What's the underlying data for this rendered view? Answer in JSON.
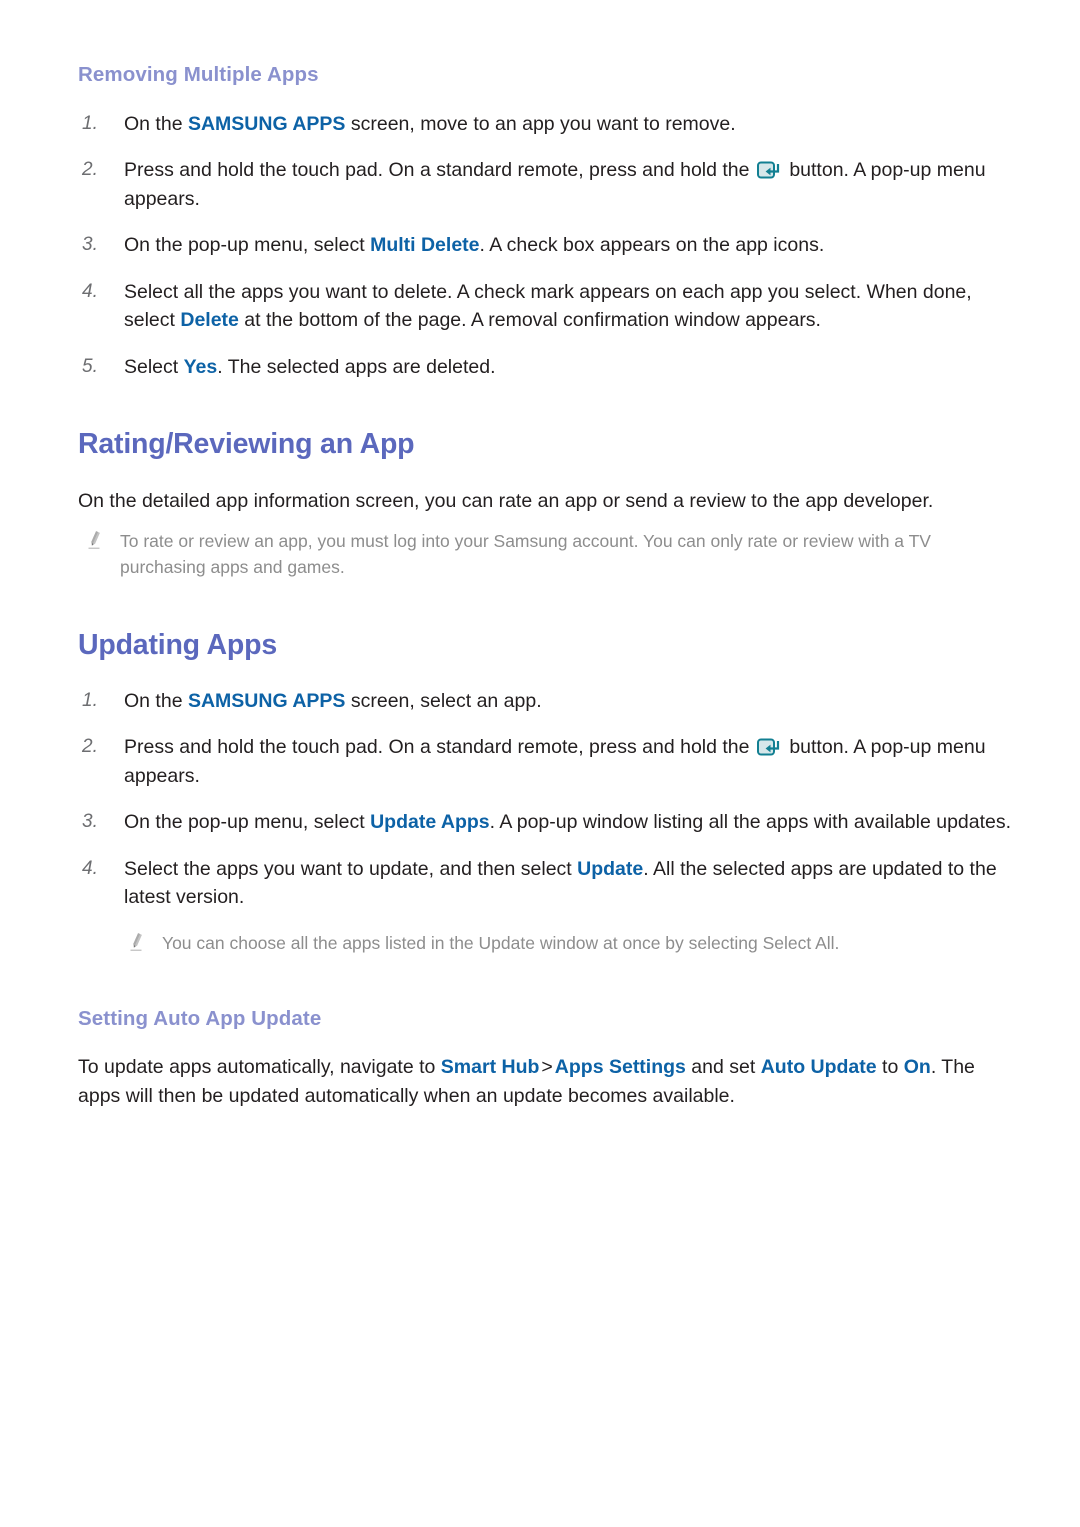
{
  "page": {
    "background": "#ffffff",
    "accent_heading_color": "#5b68bd",
    "accent_subheading_color": "#8a91ce",
    "link_color": "#0d62a6",
    "note_color": "#8d8d8d",
    "body_color": "#231f20"
  },
  "sections": [
    {
      "id": "removing-multiple-apps",
      "level": "h3",
      "title": "Removing Multiple Apps",
      "steps": [
        {
          "num": "1.",
          "parts": [
            {
              "t": "text",
              "v": "On the "
            },
            {
              "t": "hl",
              "v": "SAMSUNG APPS"
            },
            {
              "t": "text",
              "v": " screen, move to an app you want to remove."
            }
          ]
        },
        {
          "num": "2.",
          "parts": [
            {
              "t": "text",
              "v": "Press and hold the touch pad. On a standard remote, press and hold the "
            },
            {
              "t": "icon",
              "v": "enter-button-icon"
            },
            {
              "t": "text",
              "v": " button. A pop-up menu appears."
            }
          ]
        },
        {
          "num": "3.",
          "parts": [
            {
              "t": "text",
              "v": "On the pop-up menu, select "
            },
            {
              "t": "hl",
              "v": "Multi Delete"
            },
            {
              "t": "text",
              "v": ". A check box appears on the app icons."
            }
          ]
        },
        {
          "num": "4.",
          "parts": [
            {
              "t": "text",
              "v": "Select all the apps you want to delete. A check mark appears on each app you select. When done, select "
            },
            {
              "t": "hl",
              "v": "Delete"
            },
            {
              "t": "text",
              "v": " at the bottom of the page. A removal confirmation window appears."
            }
          ]
        },
        {
          "num": "5.",
          "parts": [
            {
              "t": "text",
              "v": "Select "
            },
            {
              "t": "hl",
              "v": "Yes"
            },
            {
              "t": "text",
              "v": ". The selected apps are deleted."
            }
          ]
        }
      ]
    },
    {
      "id": "rating-reviewing-an-app",
      "level": "h2",
      "title": "Rating/Reviewing an App",
      "paragraph": "On the detailed app information screen, you can rate an app or send a review to the app developer.",
      "note": "To rate or review an app, you must log into your Samsung account. You can only rate or review with a TV purchasing apps and games."
    },
    {
      "id": "updating-apps",
      "level": "h2",
      "title": "Updating Apps",
      "steps": [
        {
          "num": "1.",
          "parts": [
            {
              "t": "text",
              "v": "On the "
            },
            {
              "t": "hl",
              "v": "SAMSUNG APPS"
            },
            {
              "t": "text",
              "v": " screen, select an app."
            }
          ]
        },
        {
          "num": "2.",
          "parts": [
            {
              "t": "text",
              "v": "Press and hold the touch pad. On a standard remote, press and hold the "
            },
            {
              "t": "icon",
              "v": "enter-button-icon"
            },
            {
              "t": "text",
              "v": " button. A pop-up menu appears."
            }
          ]
        },
        {
          "num": "3.",
          "parts": [
            {
              "t": "text",
              "v": "On the pop-up menu, select "
            },
            {
              "t": "hl",
              "v": "Update Apps"
            },
            {
              "t": "text",
              "v": ". A pop-up window listing all the apps with available updates."
            }
          ]
        },
        {
          "num": "4.",
          "parts": [
            {
              "t": "text",
              "v": "Select the apps you want to update, and then select "
            },
            {
              "t": "hl",
              "v": "Update"
            },
            {
              "t": "text",
              "v": ". All the selected apps are updated to the latest version."
            }
          ]
        }
      ],
      "note": "You can choose all the apps listed in the Update window at once by selecting Select All."
    },
    {
      "id": "setting-auto-app-update",
      "level": "h3",
      "title": "Setting Auto App Update",
      "paragraph_parts": [
        {
          "t": "text",
          "v": "To update apps automatically, navigate to "
        },
        {
          "t": "hl",
          "v": "Smart Hub"
        },
        {
          "t": "sep",
          "v": ">"
        },
        {
          "t": "hl",
          "v": "Apps Settings"
        },
        {
          "t": "text",
          "v": " and set "
        },
        {
          "t": "hl",
          "v": "Auto Update"
        },
        {
          "t": "text",
          "v": " to "
        },
        {
          "t": "hl",
          "v": "On"
        },
        {
          "t": "text",
          "v": ". The apps will then be updated automatically when an update becomes available."
        }
      ]
    }
  ],
  "icons": {
    "enter_button": {
      "name": "enter-button-icon",
      "color": "#127f92",
      "fill": "#cfe4e8"
    },
    "pencil_note": {
      "name": "pencil-icon",
      "color": "#b0b0b0"
    }
  }
}
